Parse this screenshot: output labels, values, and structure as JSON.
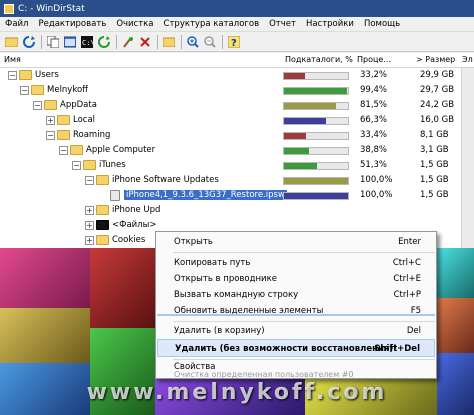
{
  "window": {
    "title": "C: - WinDirStat"
  },
  "menu": [
    "Файл",
    "Редактировать",
    "Очистка",
    "Структура каталогов",
    "Отчет",
    "Настройки",
    "Помощь"
  ],
  "toolbar": {
    "icons": [
      "open-icon",
      "refresh-icon",
      "copy-icon",
      "explorer-icon",
      "cmd-icon",
      "refresh-all-icon",
      "cleanup-icon",
      "delete-icon",
      "properties-icon",
      "zoom-in-icon",
      "zoom-out-icon",
      "help-icon"
    ]
  },
  "columns": {
    "name": "Имя",
    "subtree": "Подкаталоги, %",
    "percent": "Проце...",
    "size": "> Размер",
    "items": "Эл"
  },
  "tree": [
    {
      "name": "Users",
      "bar": 0.33,
      "color": "#9b3b3b",
      "pct": "33,2%",
      "size": "29,9 GB"
    },
    {
      "name": "Melnykoff",
      "bar": 0.99,
      "color": "#3d9b3d",
      "pct": "99,4%",
      "size": "29,7 GB"
    },
    {
      "name": "AppData",
      "bar": 0.82,
      "color": "#9b9b45",
      "pct": "81,5%",
      "size": "24,2 GB"
    },
    {
      "name": "Local",
      "bar": 0.66,
      "color": "#3d3d9b",
      "pct": "66,3%",
      "size": "16,0 GB"
    },
    {
      "name": "Roaming",
      "bar": 0.34,
      "color": "#9b3b3b",
      "pct": "33,4%",
      "size": "8,1 GB"
    },
    {
      "name": "Apple Computer",
      "bar": 0.39,
      "color": "#3d9b3d",
      "pct": "38,8%",
      "size": "3,1 GB"
    },
    {
      "name": "iTunes",
      "bar": 0.51,
      "color": "#3d9b3d",
      "pct": "51,3%",
      "size": "1,5 GB"
    },
    {
      "name": "iPhone Software Updates",
      "bar": 1.0,
      "color": "#9b9b45",
      "pct": "100,0%",
      "size": "1,5 GB"
    },
    {
      "name": "iPhone4,1_9.3.6_13G37_Restore.ipsw",
      "bar": 1.0,
      "color": "#3d3d9b",
      "pct": "100,0%",
      "size": "1,5 GB"
    },
    {
      "name": "iPhone Upd",
      "bar": 0,
      "color": "#9b3b3b",
      "pct": "",
      "size": ""
    },
    {
      "name": "<Файлы>",
      "bar": 0,
      "color": "#9b3b3b",
      "pct": "",
      "size": ""
    },
    {
      "name": "Cookies",
      "bar": 0,
      "color": "#9b3b3b",
      "pct": "",
      "size": ""
    }
  ],
  "context_menu": [
    {
      "label": "Открыть",
      "shortcut": "Enter",
      "state": "normal"
    },
    {
      "label": "Копировать путь",
      "shortcut": "Ctrl+C",
      "state": "normal"
    },
    {
      "label": "Открыть в проводнике",
      "shortcut": "Ctrl+E",
      "state": "normal"
    },
    {
      "label": "Вызвать командную строку",
      "shortcut": "Ctrl+P",
      "state": "normal"
    },
    {
      "label": "Обновить выделенные элементы",
      "shortcut": "F5",
      "state": "normal"
    },
    {
      "label": "Удалить (в корзину)",
      "shortcut": "Del",
      "state": "normal"
    },
    {
      "label": "Удалить (без возможности восстановления)!",
      "shortcut": "Shift+Del",
      "state": "active"
    },
    {
      "label": "Свойства",
      "shortcut": "",
      "state": "normal"
    },
    {
      "label": "Очистка определенная пользователем #0",
      "shortcut": "",
      "state": "disabled"
    }
  ],
  "watermark": "www.melnykoff.com",
  "colors": {
    "titlebar": "#2a4f8a",
    "selection": "#3a6ec8",
    "menu_highlight": "#dde9f8"
  }
}
